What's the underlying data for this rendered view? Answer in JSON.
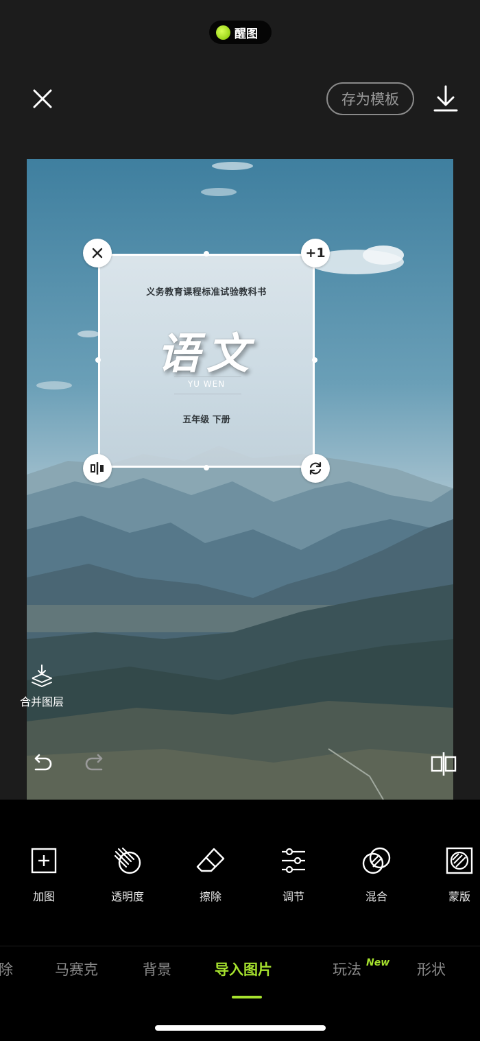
{
  "pill": {
    "label": "醒图",
    "accent": "#9bd61a"
  },
  "header": {
    "save_template_label": "存为模板"
  },
  "sticker": {
    "top_text": "义务教育课程标准试验教科书",
    "title": "语文",
    "pinyin": "YU WEN",
    "grade": "五年级  下册",
    "corner_plus_label": "+1"
  },
  "side": {
    "merge_label": "合并图层"
  },
  "toolbar": {
    "items": [
      {
        "label": "加图",
        "icon": "add-image-icon"
      },
      {
        "label": "透明度",
        "icon": "opacity-icon"
      },
      {
        "label": "擦除",
        "icon": "eraser-icon"
      },
      {
        "label": "调节",
        "icon": "adjust-sliders-icon"
      },
      {
        "label": "混合",
        "icon": "blend-icon"
      },
      {
        "label": "蒙版",
        "icon": "mask-icon"
      }
    ]
  },
  "tabs": {
    "items": [
      "除",
      "马赛克",
      "背景",
      "导入图片",
      "玩法",
      "形状"
    ],
    "active": "导入图片",
    "new_badge": "New",
    "accent": "#a6e22e"
  }
}
